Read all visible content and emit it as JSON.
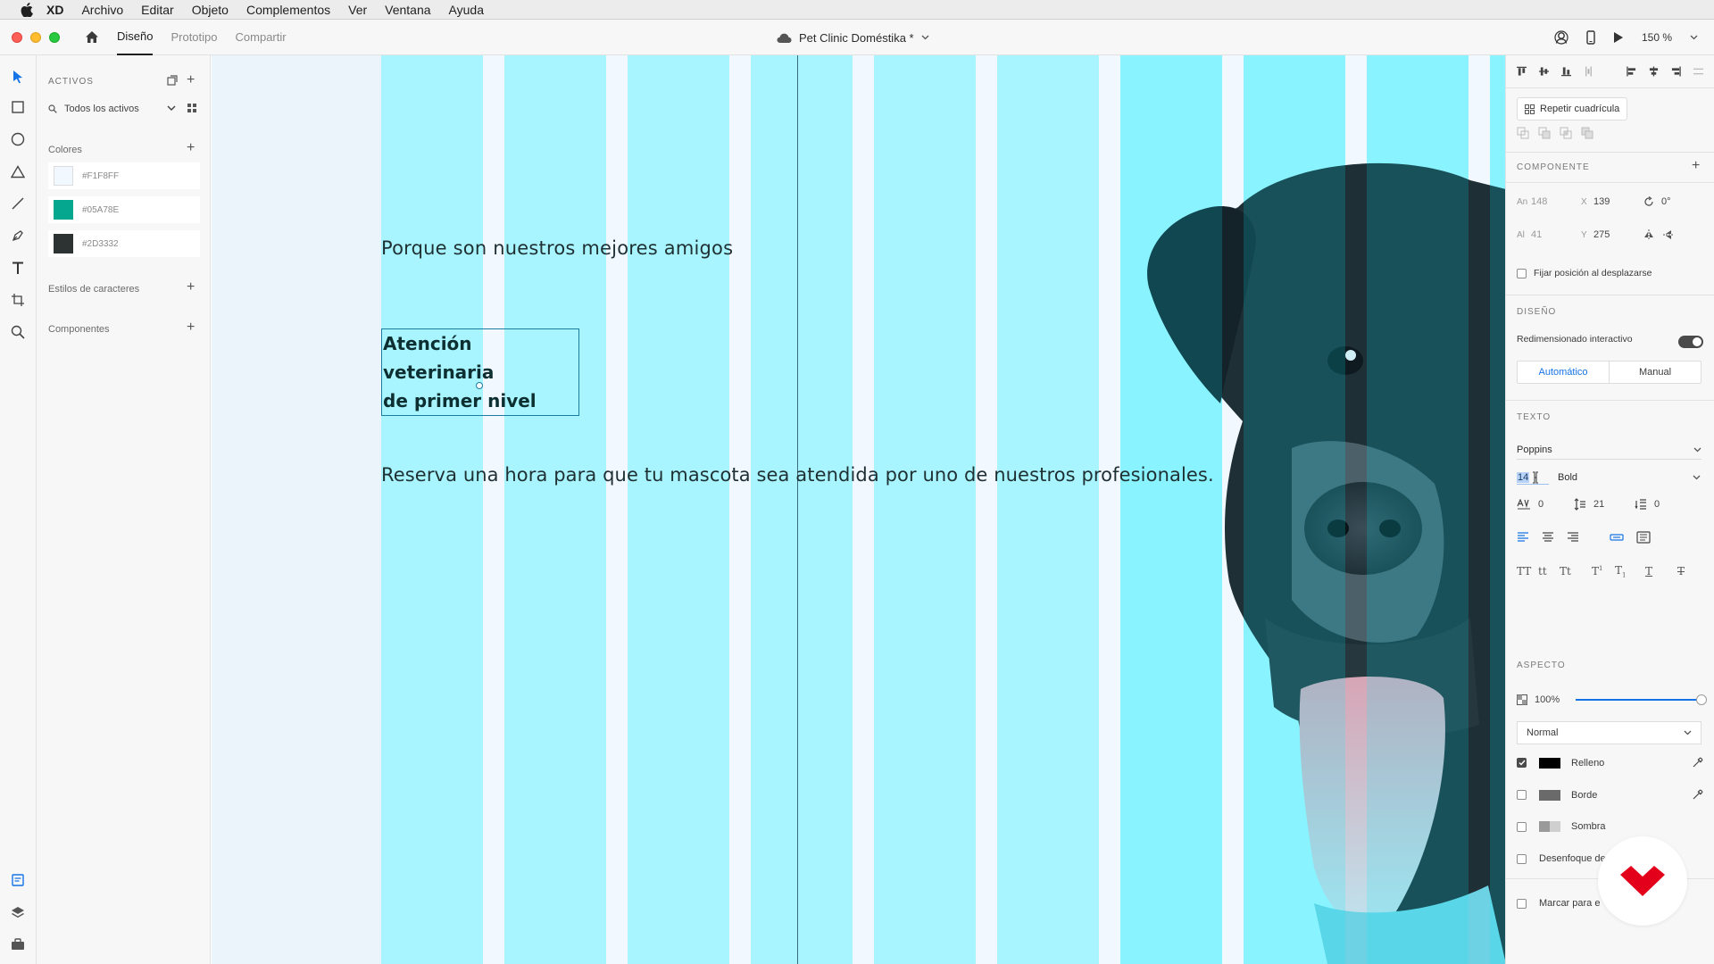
{
  "menubar": {
    "app": "XD",
    "items": [
      "Archivo",
      "Editar",
      "Objeto",
      "Complementos",
      "Ver",
      "Ventana",
      "Ayuda"
    ]
  },
  "titlebar": {
    "modes": [
      "Diseño",
      "Prototipo",
      "Compartir"
    ],
    "active_mode": "Diseño",
    "document_title": "Pet Clinic Doméstika *",
    "zoom": "150 %"
  },
  "assets": {
    "title": "ACTIVOS",
    "search_placeholder": "Todos los activos",
    "colors_title": "Colores",
    "colors": [
      {
        "hex": "#F1F8FF",
        "label": "#F1F8FF"
      },
      {
        "hex": "#05A78E",
        "label": "#05A78E"
      },
      {
        "hex": "#2D3332",
        "label": "#2D3332"
      }
    ],
    "char_styles_title": "Estilos de caracteres",
    "components_title": "Componentes"
  },
  "canvas": {
    "tagline": "Porque son nuestros mejores amigos",
    "heading_line1": "Atención veterinaria",
    "heading_line2": "de primer nivel",
    "body": "Reserva una hora para que tu mascota sea atendida por uno de nuestros profesionales.",
    "artboard_color": "#F1F8FF",
    "grid_color": "#00F0FF"
  },
  "inspector": {
    "repeat_grid": "Repetir cuadrícula",
    "component_title": "COMPONENTE",
    "width_label": "An",
    "width": "148",
    "x_label": "X",
    "x": "139",
    "rotation": "0°",
    "height_label": "Al",
    "height": "41",
    "y_label": "Y",
    "y": "275",
    "fix_position": "Fijar posición al desplazarse",
    "design_title": "DISEÑO",
    "responsive_resize": "Redimensionado interactivo",
    "auto": "Automático",
    "manual": "Manual",
    "text_title": "TEXTO",
    "font_family": "Poppins",
    "font_size": "14",
    "font_weight": "Bold",
    "char_spacing": "0",
    "line_spacing": "21",
    "paragraph_spacing": "0",
    "appearance_title": "ASPECTO",
    "opacity": "100%",
    "opacity_fraction": 1.0,
    "blend_mode": "Normal",
    "fill": "Relleno",
    "border": "Borde",
    "shadow": "Sombra",
    "bg_blur": "Desenfoque de fondo",
    "mark_export": "Marcar para e",
    "case_labels": [
      "TT",
      "tt",
      "Tt"
    ]
  }
}
